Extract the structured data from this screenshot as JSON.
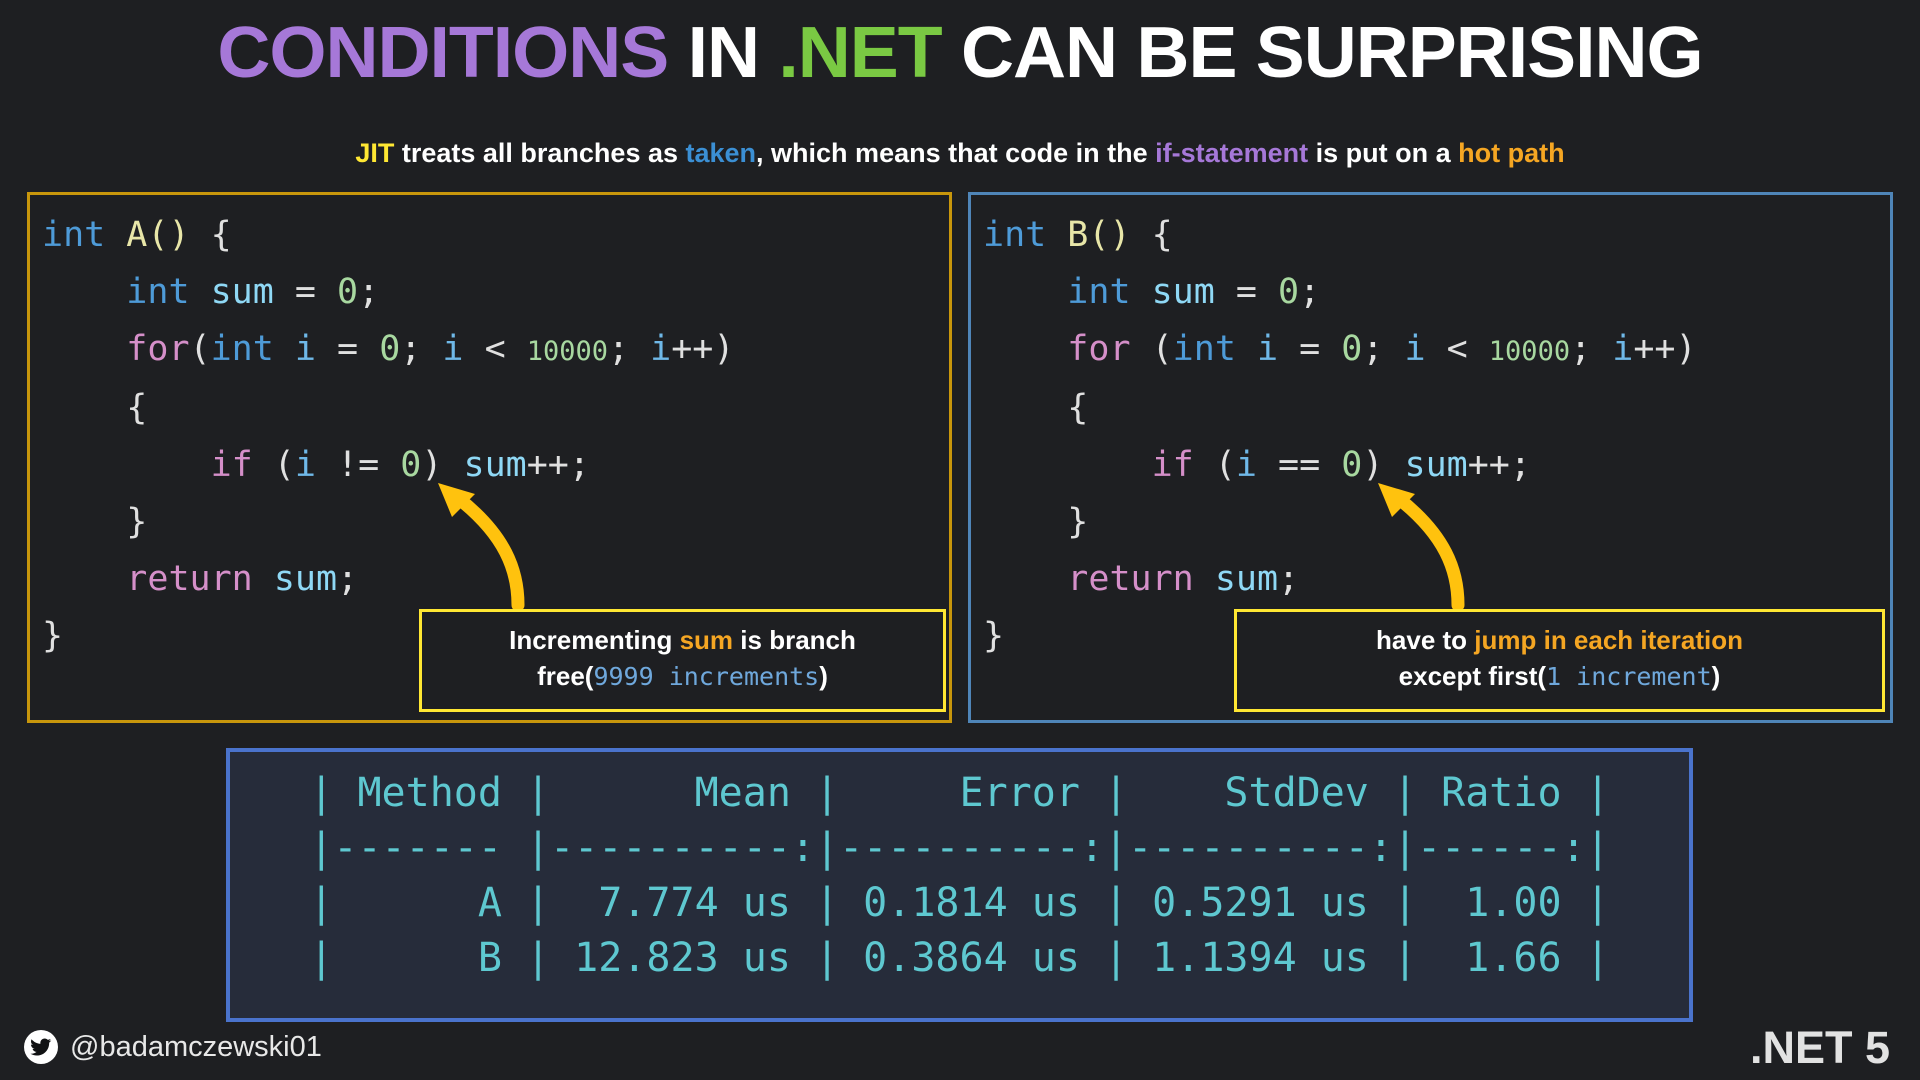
{
  "title": {
    "part1": "CONDITIONS",
    "part2": " IN ",
    "part3": ".NET",
    "part4": " CAN BE SURPRISING",
    "colors": {
      "part1": "#a678d8",
      "part3": "#7ac943",
      "rest": "#ffffff"
    }
  },
  "subtitle": {
    "jit": "JIT",
    "text1": " treats all branches as ",
    "taken": "taken",
    "text2": ", which means that code in the ",
    "if_statement": "if-statement",
    "text3": " is put on a ",
    "hot_path": "hot path",
    "colors": {
      "jit": "#ffe733",
      "taken": "#3b8fd4",
      "if_statement": "#a678d8",
      "hot_path": "#f5a623"
    }
  },
  "code_left": {
    "border_color": "#c8960c",
    "lines": [
      {
        "tokens": [
          {
            "t": "int",
            "c": "type"
          },
          {
            "t": " ",
            "c": "pl"
          },
          {
            "t": "A()",
            "c": "fn"
          },
          {
            "t": " {",
            "c": "pl"
          }
        ]
      },
      {
        "tokens": [
          {
            "t": "    ",
            "c": "pl"
          },
          {
            "t": "int",
            "c": "type"
          },
          {
            "t": " ",
            "c": "pl"
          },
          {
            "t": "sum",
            "c": "var"
          },
          {
            "t": " = ",
            "c": "pl"
          },
          {
            "t": "0",
            "c": "num"
          },
          {
            "t": ";",
            "c": "pl"
          }
        ]
      },
      {
        "tokens": [
          {
            "t": "    ",
            "c": "pl"
          },
          {
            "t": "for",
            "c": "kw"
          },
          {
            "t": "(",
            "c": "pl"
          },
          {
            "t": "int",
            "c": "type"
          },
          {
            "t": " ",
            "c": "pl"
          },
          {
            "t": "i",
            "c": "i"
          },
          {
            "t": " = ",
            "c": "pl"
          },
          {
            "t": "0",
            "c": "num"
          },
          {
            "t": "; ",
            "c": "pl"
          },
          {
            "t": "i",
            "c": "i"
          },
          {
            "t": " < ",
            "c": "pl"
          },
          {
            "t": "10000",
            "c": "numlit"
          },
          {
            "t": "; ",
            "c": "pl"
          },
          {
            "t": "i",
            "c": "i"
          },
          {
            "t": "++)",
            "c": "pl"
          }
        ]
      },
      {
        "tokens": [
          {
            "t": "    {",
            "c": "pl"
          }
        ]
      },
      {
        "tokens": [
          {
            "t": "        ",
            "c": "pl"
          },
          {
            "t": "if",
            "c": "kw"
          },
          {
            "t": " (",
            "c": "pl"
          },
          {
            "t": "i",
            "c": "i"
          },
          {
            "t": " != ",
            "c": "pl"
          },
          {
            "t": "0",
            "c": "num"
          },
          {
            "t": ") ",
            "c": "pl"
          },
          {
            "t": "sum",
            "c": "var"
          },
          {
            "t": "++;",
            "c": "pl"
          }
        ]
      },
      {
        "tokens": [
          {
            "t": "    }",
            "c": "pl"
          }
        ]
      },
      {
        "tokens": [
          {
            "t": "    ",
            "c": "pl"
          },
          {
            "t": "return",
            "c": "kw"
          },
          {
            "t": " ",
            "c": "pl"
          },
          {
            "t": "sum",
            "c": "var"
          },
          {
            "t": ";",
            "c": "pl"
          }
        ]
      },
      {
        "tokens": [
          {
            "t": "}",
            "c": "pl"
          }
        ]
      }
    ]
  },
  "code_right": {
    "border_color": "#4f85b8",
    "lines": [
      {
        "tokens": [
          {
            "t": "int",
            "c": "type"
          },
          {
            "t": " ",
            "c": "pl"
          },
          {
            "t": "B()",
            "c": "fn"
          },
          {
            "t": " {",
            "c": "pl"
          }
        ]
      },
      {
        "tokens": [
          {
            "t": "    ",
            "c": "pl"
          },
          {
            "t": "int",
            "c": "type"
          },
          {
            "t": " ",
            "c": "pl"
          },
          {
            "t": "sum",
            "c": "var"
          },
          {
            "t": " = ",
            "c": "pl"
          },
          {
            "t": "0",
            "c": "num"
          },
          {
            "t": ";",
            "c": "pl"
          }
        ]
      },
      {
        "tokens": [
          {
            "t": "    ",
            "c": "pl"
          },
          {
            "t": "for",
            "c": "kw"
          },
          {
            "t": " (",
            "c": "pl"
          },
          {
            "t": "int",
            "c": "type"
          },
          {
            "t": " ",
            "c": "pl"
          },
          {
            "t": "i",
            "c": "i"
          },
          {
            "t": " = ",
            "c": "pl"
          },
          {
            "t": "0",
            "c": "num"
          },
          {
            "t": "; ",
            "c": "pl"
          },
          {
            "t": "i",
            "c": "i"
          },
          {
            "t": " < ",
            "c": "pl"
          },
          {
            "t": "10000",
            "c": "numlit"
          },
          {
            "t": "; ",
            "c": "pl"
          },
          {
            "t": "i",
            "c": "i"
          },
          {
            "t": "++)",
            "c": "pl"
          }
        ]
      },
      {
        "tokens": [
          {
            "t": "    {",
            "c": "pl"
          }
        ]
      },
      {
        "tokens": [
          {
            "t": "        ",
            "c": "pl"
          },
          {
            "t": "if",
            "c": "kw"
          },
          {
            "t": " (",
            "c": "pl"
          },
          {
            "t": "i",
            "c": "i"
          },
          {
            "t": " == ",
            "c": "pl"
          },
          {
            "t": "0",
            "c": "num"
          },
          {
            "t": ") ",
            "c": "pl"
          },
          {
            "t": "sum",
            "c": "var"
          },
          {
            "t": "++;",
            "c": "pl"
          }
        ]
      },
      {
        "tokens": [
          {
            "t": "    }",
            "c": "pl"
          }
        ]
      },
      {
        "tokens": [
          {
            "t": "    ",
            "c": "pl"
          },
          {
            "t": "return",
            "c": "kw"
          },
          {
            "t": " ",
            "c": "pl"
          },
          {
            "t": "sum",
            "c": "var"
          },
          {
            "t": ";",
            "c": "pl"
          }
        ]
      },
      {
        "tokens": [
          {
            "t": "}",
            "c": "pl"
          }
        ]
      }
    ]
  },
  "callout_left": {
    "line1_a": "Incrementing ",
    "line1_b": "sum",
    "line1_c": " is branch",
    "line2_a": "free",
    "line2_paren_open": "(",
    "line2_mono": "9999 increments",
    "line2_paren_close": ")",
    "border_color": "#ffe733",
    "highlight_color": "#f5a623",
    "mono_color": "#6fa8dc"
  },
  "callout_right": {
    "line1_a": "have to ",
    "line1_b": "jump in each iteration",
    "line2_a": "except first",
    "line2_paren_open": "(",
    "line2_mono": "1 increment",
    "line2_paren_close": ")",
    "border_color": "#ffe733",
    "highlight_color": "#f5a623",
    "mono_color": "#6fa8dc"
  },
  "bench_table": {
    "border_color": "#4a73cc",
    "background": "#262c3a",
    "text_color": "#5ec8d0",
    "columns": [
      "Method",
      "Mean",
      "Error",
      "StdDev",
      "Ratio"
    ],
    "header_line": "| Method |      Mean |     Error |    StdDev | Ratio |",
    "separator_line": "|------- |----------:|----------:|----------:|------:|",
    "rows": [
      {
        "line": "|      A |  7.774 us | 0.1814 us | 0.5291 us |  1.00 |",
        "Method": "A",
        "Mean": "7.774 us",
        "Error": "0.1814 us",
        "StdDev": "0.5291 us",
        "Ratio": "1.00"
      },
      {
        "line": "|      B | 12.823 us | 0.3864 us | 1.1394 us |  1.66 |",
        "Method": "B",
        "Mean": "12.823 us",
        "Error": "0.3864 us",
        "StdDev": "1.1394 us",
        "Ratio": "1.66"
      }
    ]
  },
  "footer": {
    "handle": "@badamczewski01",
    "version": ".NET 5"
  },
  "arrows": {
    "color": "#ffc20e",
    "left_label": "curved-arrow-pointing-to-not-equal-operator",
    "right_label": "curved-arrow-pointing-to-equality-operator"
  }
}
